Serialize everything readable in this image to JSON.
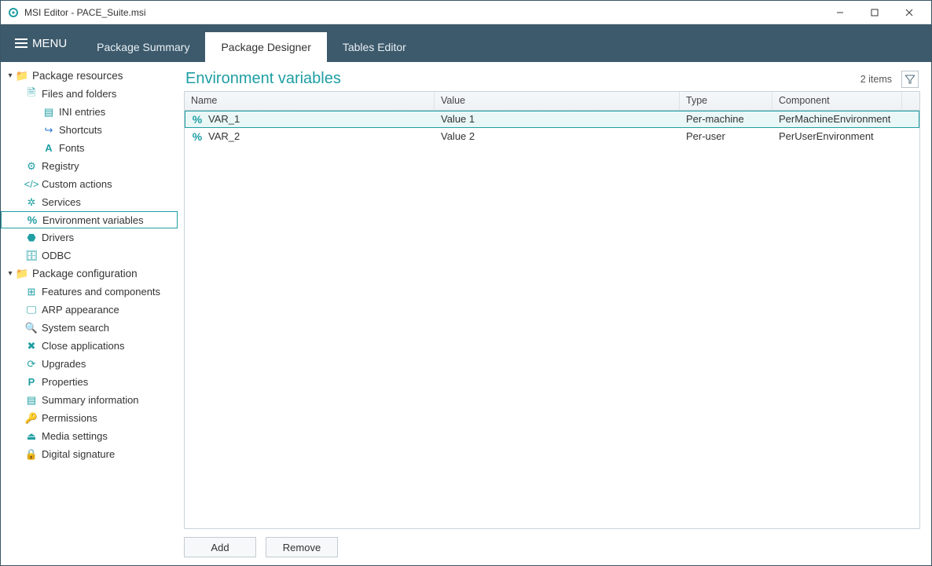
{
  "window": {
    "title": "MSI Editor - PACE_Suite.msi"
  },
  "menubar": {
    "menu_label": "MENU",
    "tabs": [
      {
        "label": "Package Summary"
      },
      {
        "label": "Package Designer"
      },
      {
        "label": "Tables Editor"
      }
    ]
  },
  "sidebar": {
    "group_resources": "Package resources",
    "files_folders": "Files and folders",
    "ini_entries": "INI entries",
    "shortcuts": "Shortcuts",
    "fonts": "Fonts",
    "registry": "Registry",
    "custom_actions": "Custom actions",
    "services": "Services",
    "env_vars": "Environment variables",
    "drivers": "Drivers",
    "odbc": "ODBC",
    "group_config": "Package configuration",
    "features": "Features and components",
    "arp": "ARP appearance",
    "system_search": "System search",
    "close_apps": "Close applications",
    "upgrades": "Upgrades",
    "properties": "Properties",
    "summary_info": "Summary information",
    "permissions": "Permissions",
    "media": "Media settings",
    "digital_sig": "Digital signature"
  },
  "content": {
    "title": "Environment variables",
    "items_count": "2 items",
    "columns": {
      "name": "Name",
      "value": "Value",
      "type": "Type",
      "component": "Component"
    },
    "rows": [
      {
        "name": "VAR_1",
        "value": "Value 1",
        "type": "Per-machine",
        "component": "PerMachineEnvironment"
      },
      {
        "name": "VAR_2",
        "value": "Value 2",
        "type": "Per-user",
        "component": "PerUserEnvironment"
      }
    ],
    "buttons": {
      "add": "Add",
      "remove": "Remove"
    }
  }
}
